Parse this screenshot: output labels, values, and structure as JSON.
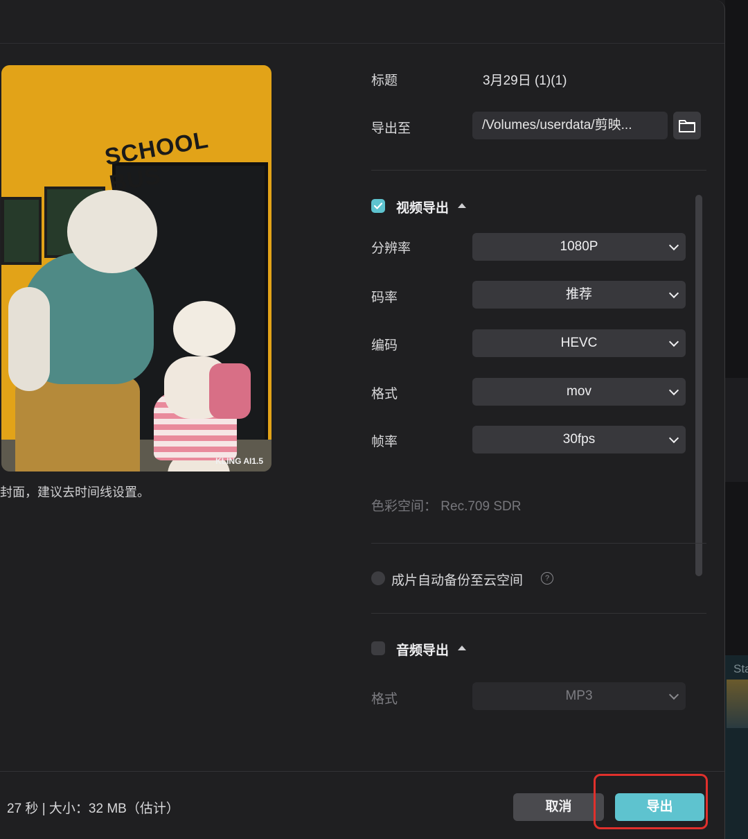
{
  "preview": {
    "bus_sign": "SCHOOL BUS",
    "watermark": "KLING AI1.5",
    "cover_note": "封面，建议去时间线设置。"
  },
  "form": {
    "title_label": "标题",
    "title_value": "3月29日 (1)(1)",
    "export_to_label": "导出至",
    "export_path": "/Volumes/userdata/剪映...",
    "folder_icon": "folder-icon"
  },
  "video_export": {
    "checked": true,
    "title": "视频导出",
    "fields": [
      {
        "label": "分辨率",
        "value": "1080P"
      },
      {
        "label": "码率",
        "value": "推荐"
      },
      {
        "label": "编码",
        "value": "HEVC"
      },
      {
        "label": "格式",
        "value": "mov"
      },
      {
        "label": "帧率",
        "value": "30fps"
      }
    ],
    "color_space": "色彩空间： Rec.709 SDR"
  },
  "cloud_backup": {
    "checked": false,
    "label": "成片自动备份至云空间"
  },
  "audio_export": {
    "checked": false,
    "title": "音频导出",
    "format_label": "格式",
    "format_value": "MP3"
  },
  "footer": {
    "info": "27 秒 | 大小：32 MB（估计）",
    "cancel_label": "取消",
    "export_label": "导出"
  },
  "background": {
    "partial_text": "Sta"
  },
  "colors": {
    "accent": "#5ec3cf",
    "highlight": "#e0302c"
  }
}
